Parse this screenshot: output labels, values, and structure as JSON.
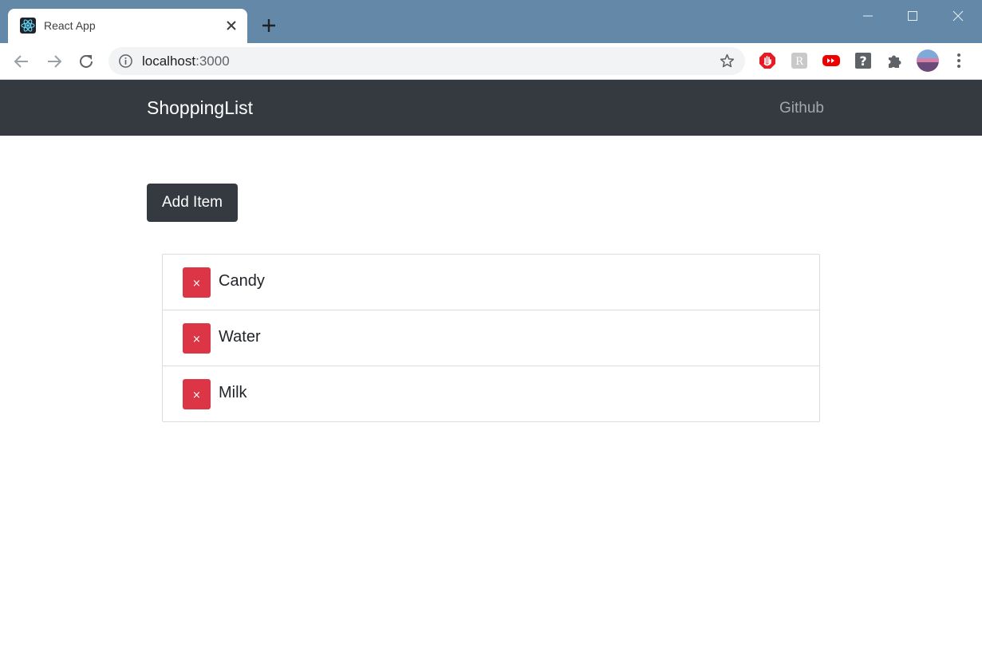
{
  "browser": {
    "tab_title": "React App",
    "url_host": "localhost",
    "url_port": ":3000",
    "favicon": "react-logo-icon",
    "extensions": [
      "adblock-icon",
      "extension-r-icon",
      "youtube-icon",
      "help-icon",
      "puzzle-icon",
      "profile-avatar"
    ]
  },
  "navbar": {
    "brand": "ShoppingList",
    "link": "Github"
  },
  "main": {
    "add_button": "Add Item",
    "remove_symbol": "×",
    "items": [
      {
        "name": "Candy"
      },
      {
        "name": "Water"
      },
      {
        "name": "Milk"
      }
    ]
  },
  "colors": {
    "titlebar": "#6489a8",
    "navbar": "#343a40",
    "danger": "#dc3545"
  }
}
